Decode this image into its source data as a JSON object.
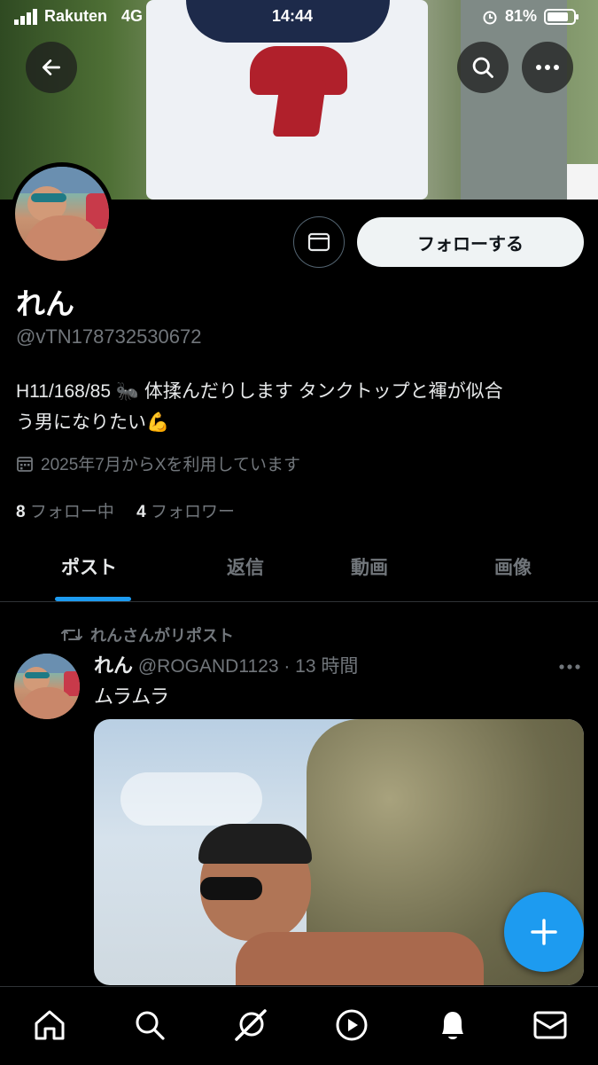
{
  "status_bar": {
    "carrier": "Rakuten",
    "network": "4G",
    "time": "14:44",
    "battery": "81%"
  },
  "profile": {
    "name": "れん",
    "handle": "@vTN178732530672",
    "bio_line1": "H11/168/85 🐜 体揉んだりします タンクトップと褌が似合",
    "bio_line2": "う男になりたい💪",
    "joined": "2025年7月からXを利用しています",
    "following_count": "8",
    "following_label": "フォロー中",
    "followers_count": "4",
    "followers_label": "フォロワー",
    "follow_button": "フォローする"
  },
  "tabs": [
    "ポスト",
    "返信",
    "動画",
    "画像"
  ],
  "post": {
    "repost_label": "れんさんがリポスト",
    "author": "れん",
    "handle_time": "@ROGAND1123 · 13 時間",
    "text": "ムラムラ"
  },
  "icons": [
    "back-arrow-icon",
    "search-icon",
    "more-icon",
    "mail-icon",
    "calendar-icon",
    "repost-icon",
    "plus-icon",
    "home-icon",
    "explore-icon",
    "grok-icon",
    "video-icon",
    "notifications-icon",
    "messages-icon"
  ],
  "colors": {
    "accent": "#1d9bf0",
    "background": "#000000",
    "muted": "#71767b"
  }
}
